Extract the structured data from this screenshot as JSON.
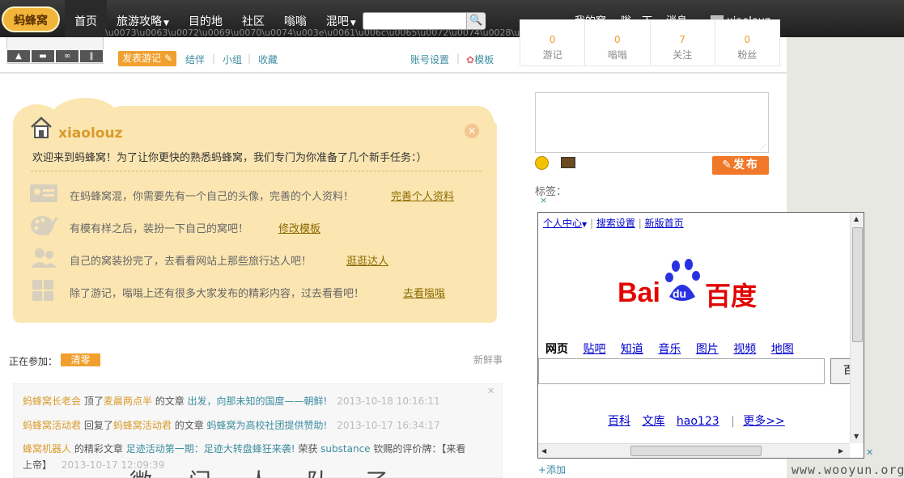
{
  "brand": {
    "logo_text": "蚂蜂窝"
  },
  "nav": {
    "items": [
      {
        "label": "首页",
        "caret": false
      },
      {
        "label": "旅游攻略",
        "caret": true
      },
      {
        "label": "目的地",
        "caret": false
      },
      {
        "label": "社区",
        "caret": false
      },
      {
        "label": "嗡嗡",
        "caret": false
      },
      {
        "label": "混吧",
        "caret": true
      }
    ],
    "search_placeholder": "",
    "right": {
      "my_nest": "我的窝",
      "weng": "嗡一下",
      "messages": "消息",
      "username": "xiaolouz"
    }
  },
  "profile": {
    "garbled_text": "\\u0073\\u0063\\u0072\\u0069\\u0070\\u0074\\u003e\\u0061\\u006c\\u0065\\u0072\\u0074\\u0028\\u0030",
    "post_button": "发表游记",
    "tabs": [
      "结伴",
      "小组",
      "收藏"
    ],
    "settings": "账号设置",
    "template": "模板",
    "stats": [
      {
        "num": "0",
        "label": "游记"
      },
      {
        "num": "0",
        "label": "嗡嗡"
      },
      {
        "num": "7",
        "label": "关注"
      },
      {
        "num": "0",
        "label": "粉丝"
      }
    ]
  },
  "welcome": {
    "name": "xiaolouz",
    "intro": "欢迎来到蚂蜂窝！为了让你更快的熟悉蚂蜂窝，我们专门为你准备了几个新手任务：）",
    "tasks": [
      {
        "text": "在蚂蜂窝混，你需要先有一个自己的头像，完善的个人资料！",
        "link": "完善个人资料"
      },
      {
        "text": "有模有样之后，装扮一下自己的窝吧！",
        "link": "修改模板"
      },
      {
        "text": "自己的窝装扮完了，去看看网站上那些旅行达人吧！",
        "link": "逛逛达人"
      },
      {
        "text": "除了游记，嗡嗡上还有很多大家发布的精彩内容，过去看看吧！",
        "link": "去看嗡嗡"
      }
    ]
  },
  "joining": {
    "label": "正在参加：",
    "tag": "清零",
    "fresh": "新鲜事"
  },
  "feed": [
    {
      "user": "蚂蜂窝长老会",
      "action": "顶了",
      "user2": "麦晨两点半",
      "mid": "的文章",
      "title": "出发，向那未知的国度——朝鲜!",
      "time": "2013-10-18 10:16:11"
    },
    {
      "user": "蚂蜂窝活动君",
      "action": "回复了",
      "user2": "蚂蜂窝活动君",
      "mid": "的文章",
      "title": "蚂蜂窝为高校社团提供赞助!",
      "time": "2013-10-17 16:34:17"
    },
    {
      "user": "蜂窝机器人",
      "action": "的精彩文章",
      "user2": "",
      "mid": "",
      "title": "足迹活动第一期：足迹大转盘蜂狂来袭!",
      "extra": "荣获",
      "award_user": "substance",
      "award": "钦赐的评价牌：【来看"
    },
    {
      "user": "",
      "action": "上帝】",
      "user2": "",
      "mid": "",
      "title": "",
      "time": "2013-10-17 12:09:39"
    }
  ],
  "right": {
    "tag_label": "标签：",
    "close": "×",
    "publish": "发布",
    "add": "+添加"
  },
  "baidu": {
    "top_links": [
      "个人中心",
      "搜索设置",
      "新版首页"
    ],
    "logo_left": "Bai",
    "logo_paw": "du",
    "logo_right": "百度",
    "tabs": [
      "网页",
      "贴吧",
      "知道",
      "音乐",
      "图片",
      "视频",
      "地图"
    ],
    "search_btn": "百",
    "bottom_links": [
      "百科",
      "文库",
      "hao123",
      "更多>>"
    ]
  },
  "watermark": "www.wooyun.org",
  "bottom_partial": "微   门 人 队   了 ……",
  "colors": {
    "accent": "#f0a02e",
    "topbar": "#2b2b2b",
    "link": "#3c8ca0",
    "panel": "#fbe6b2"
  }
}
